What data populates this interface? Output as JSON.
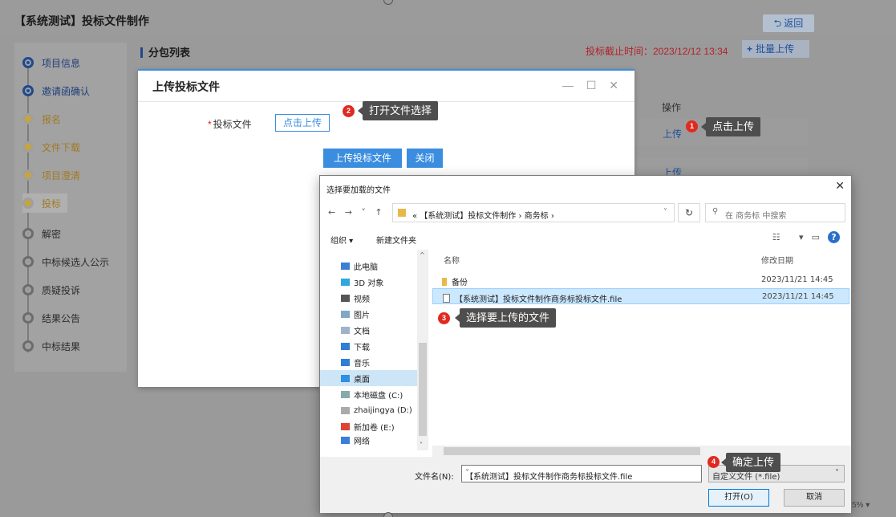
{
  "header": {
    "title": "【系统测试】投标文件制作",
    "back_label": "返回",
    "back_icon": "back-arrow-icon"
  },
  "steps": [
    {
      "label": "项目信息",
      "state": "done"
    },
    {
      "label": "邀请函确认",
      "state": "done"
    },
    {
      "label": "报名",
      "state": "pending"
    },
    {
      "label": "文件下载",
      "state": "pending"
    },
    {
      "label": "项目澄清",
      "state": "pending"
    },
    {
      "label": "投标",
      "state": "current"
    },
    {
      "label": "解密",
      "state": "todo"
    },
    {
      "label": "中标候选人公示",
      "state": "todo"
    },
    {
      "label": "质疑投诉",
      "state": "todo"
    },
    {
      "label": "结果公告",
      "state": "todo"
    },
    {
      "label": "中标结果",
      "state": "todo"
    }
  ],
  "main": {
    "title": "分包列表",
    "deadline": "投标截止时间：2023/12/12 13:34",
    "batch_upload": "批量上传",
    "ops_header": "操作",
    "row_action_1": "上传",
    "row_action_2": "上传"
  },
  "upload_dialog": {
    "title": "上传投标文件",
    "controls": "— ☐ ✕",
    "field_label": "投标文件",
    "choose_label": "点击上传",
    "submit_label": "上传投标文件",
    "close_label": "关闭"
  },
  "callouts": [
    {
      "num": "1",
      "text": "点击上传"
    },
    {
      "num": "2",
      "text": "打开文件选择"
    },
    {
      "num": "3",
      "text": "选择要上传的文件"
    },
    {
      "num": "4",
      "text": "确定上传"
    }
  ],
  "file_dialog": {
    "title": "选择要加载的文件",
    "nav": "← → ˅ ↑",
    "path": "« 【系统测试】投标文件制作 › 商务标 ›",
    "search_placeholder": "在 商务标 中搜索",
    "organize": "组织 ▾",
    "new_folder": "新建文件夹",
    "col_name": "名称",
    "col_date": "修改日期",
    "tree": [
      {
        "label": "此电脑",
        "icon": "computer-icon"
      },
      {
        "label": "3D 对象",
        "icon": "cube-icon"
      },
      {
        "label": "视频",
        "icon": "video-icon"
      },
      {
        "label": "图片",
        "icon": "picture-icon"
      },
      {
        "label": "文档",
        "icon": "document-icon"
      },
      {
        "label": "下载",
        "icon": "download-icon"
      },
      {
        "label": "音乐",
        "icon": "music-icon"
      },
      {
        "label": "桌面",
        "icon": "desktop-icon"
      },
      {
        "label": "本地磁盘 (C:)",
        "icon": "drive-icon"
      },
      {
        "label": "zhaijingya (D:)",
        "icon": "drive-icon"
      },
      {
        "label": "新加卷 (E:)",
        "icon": "drive-icon"
      },
      {
        "label": "网络",
        "icon": "network-icon"
      }
    ],
    "files": [
      {
        "name": "备份",
        "date": "2023/11/21 14:45",
        "type": "folder"
      },
      {
        "name": "【系统测试】投标文件制作商务标投标文件.file",
        "date": "2023/11/21 14:45",
        "type": "file"
      }
    ],
    "filename_label": "文件名(N):",
    "filename_value": "【系统测试】投标文件制作商务标投标文件.file",
    "filetype_value": "自定义文件 (*.file)",
    "open_label": "打开(O)",
    "cancel_label": "取消"
  },
  "zoom": "5% ▾",
  "colors": {
    "accent": "#3b8de0",
    "deadline": "#b2222a",
    "badge": "#e02a20"
  }
}
